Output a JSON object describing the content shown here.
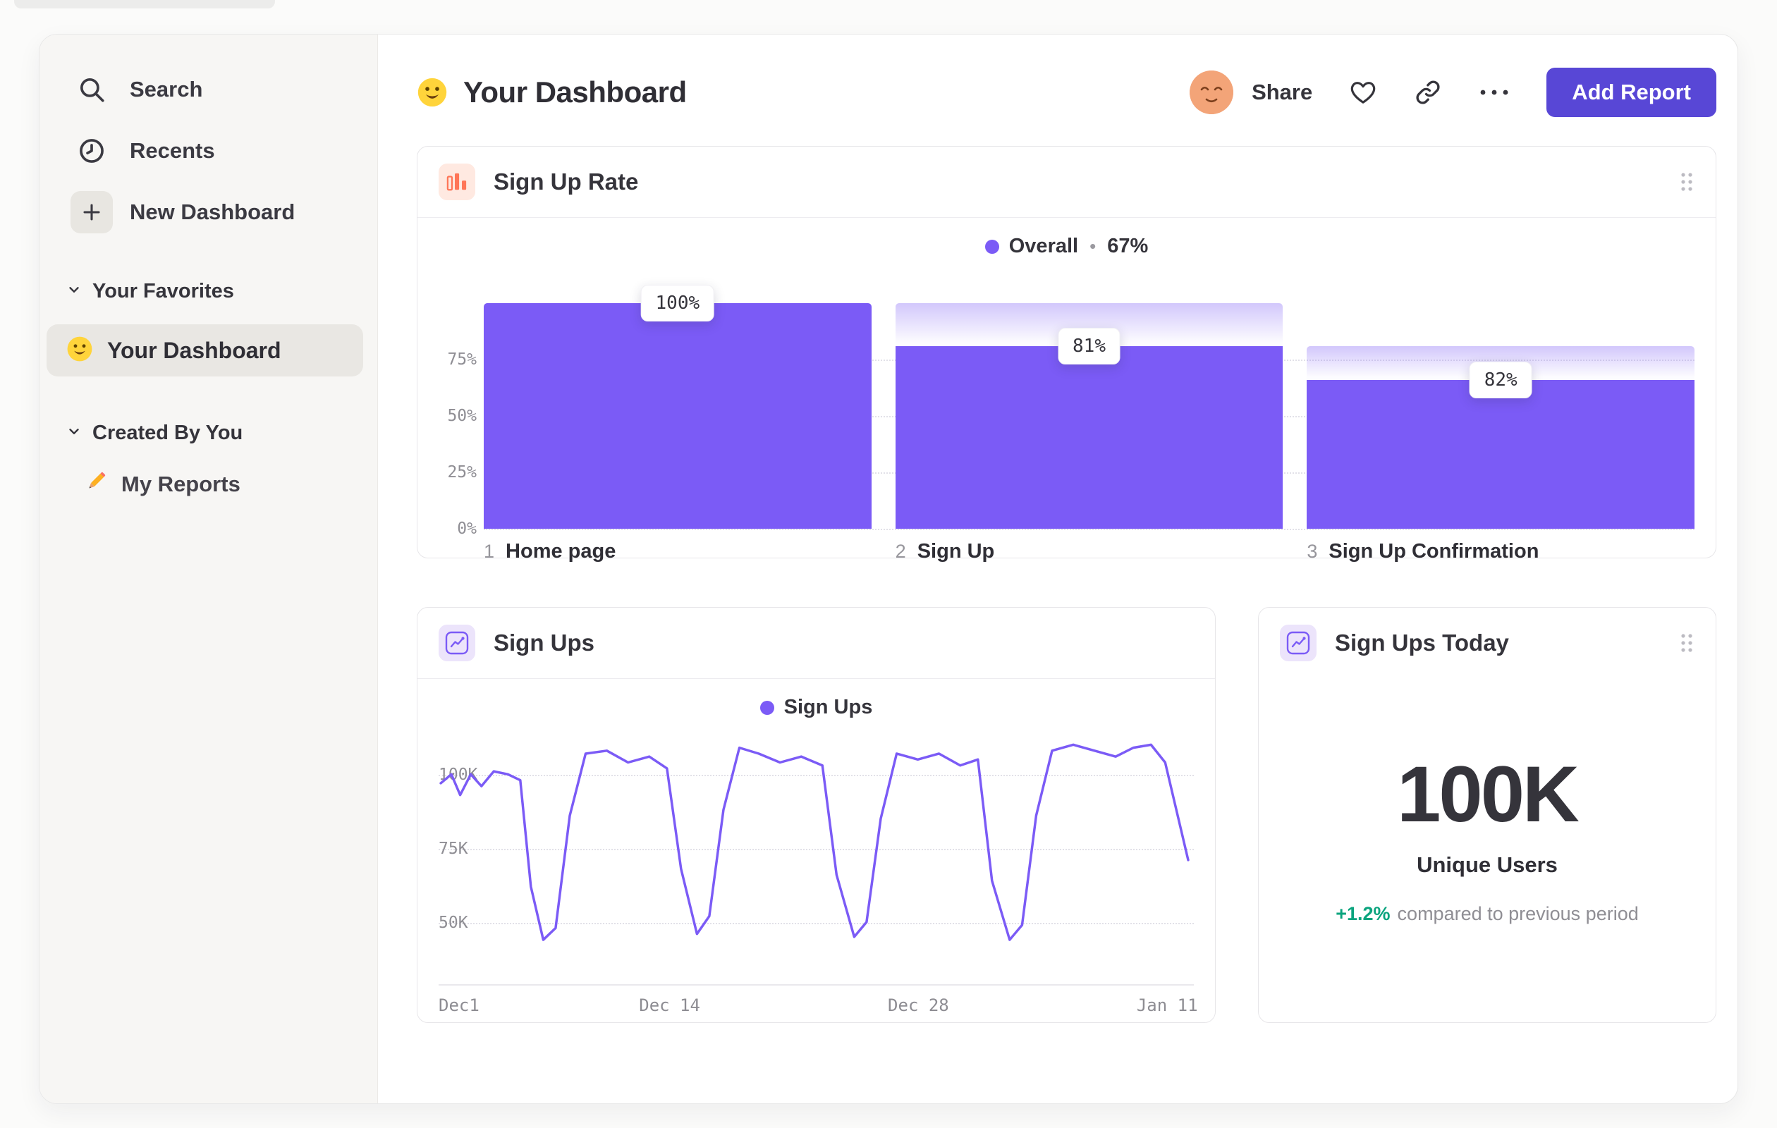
{
  "app": {
    "background": "#fbfbfa"
  },
  "colors": {
    "accent_purple": "#7b5bf6",
    "button_purple": "#5847d6",
    "accent_orange": "#ff7557",
    "positive_green": "#0ba47e"
  },
  "sidebar": {
    "nav": [
      {
        "label": "Search",
        "icon": "search-icon"
      },
      {
        "label": "Recents",
        "icon": "clock-icon"
      },
      {
        "label": "New Dashboard",
        "icon": "plus-icon"
      }
    ],
    "sections": [
      {
        "label": "Your Favorites",
        "items": [
          {
            "label": "Your Dashboard",
            "icon": "smiley-icon",
            "selected": true
          }
        ]
      },
      {
        "label": "Created By You",
        "items": [
          {
            "label": "My Reports",
            "icon": "pencil-icon",
            "selected": false
          }
        ]
      }
    ]
  },
  "header": {
    "title": "Your Dashboard",
    "title_icon": "smiley-icon",
    "avatar_icon": "relieved-face-icon",
    "share_label": "Share",
    "add_report_label": "Add Report"
  },
  "chart_data": [
    {
      "type": "bar",
      "variant": "funnel",
      "title": "Sign Up Rate",
      "legend": {
        "label": "Overall",
        "separator": "•",
        "value": "67%"
      },
      "ylabel_ticks": [
        "75%",
        "50%",
        "25%",
        "0%"
      ],
      "ylim": [
        0,
        100
      ],
      "steps": [
        {
          "num": "1",
          "label": "Home page",
          "value_label": "100%",
          "height_pct": 100
        },
        {
          "num": "2",
          "label": "Sign Up",
          "value_label": "81%",
          "height_pct": 81
        },
        {
          "num": "3",
          "label": "Sign Up Confirmation",
          "value_label": "82%",
          "height_pct": 66
        }
      ]
    },
    {
      "type": "line",
      "title": "Sign Ups",
      "legend": {
        "label": "Sign Ups"
      },
      "x_ticks": [
        {
          "label": "Dec1",
          "day": 0
        },
        {
          "label": "Dec 14",
          "day": 13
        },
        {
          "label": "Dec 28",
          "day": 27
        },
        {
          "label": "Jan 11",
          "day": 41
        }
      ],
      "x_range": [
        0,
        42.5
      ],
      "y_ticks": [
        {
          "label": "100K",
          "value": 100
        },
        {
          "label": "75K",
          "value": 75
        },
        {
          "label": "50K",
          "value": 50
        }
      ],
      "ylim": [
        29,
        112
      ],
      "unit": "K",
      "series": [
        {
          "name": "Sign Ups",
          "points": [
            [
              0,
              97
            ],
            [
              0.6,
              100
            ],
            [
              1.1,
              93
            ],
            [
              1.7,
              100
            ],
            [
              2.3,
              96
            ],
            [
              3,
              101
            ],
            [
              3.8,
              100
            ],
            [
              4.5,
              98
            ],
            [
              5.1,
              62
            ],
            [
              5.8,
              44
            ],
            [
              6.5,
              48
            ],
            [
              7.3,
              86
            ],
            [
              8.2,
              107
            ],
            [
              9.4,
              108
            ],
            [
              10.6,
              104
            ],
            [
              11.8,
              106
            ],
            [
              12.8,
              102
            ],
            [
              13.6,
              68
            ],
            [
              14.5,
              46
            ],
            [
              15.2,
              52
            ],
            [
              16,
              88
            ],
            [
              16.9,
              109
            ],
            [
              18,
              107
            ],
            [
              19.2,
              104
            ],
            [
              20.4,
              106
            ],
            [
              21.6,
              103
            ],
            [
              22.4,
              66
            ],
            [
              23.4,
              45
            ],
            [
              24.1,
              50
            ],
            [
              24.9,
              85
            ],
            [
              25.8,
              107
            ],
            [
              27,
              105
            ],
            [
              28.2,
              107
            ],
            [
              29.4,
              103
            ],
            [
              30.4,
              105
            ],
            [
              31.2,
              64
            ],
            [
              32.2,
              44
            ],
            [
              32.9,
              49
            ],
            [
              33.7,
              86
            ],
            [
              34.6,
              108
            ],
            [
              35.8,
              110
            ],
            [
              37,
              108
            ],
            [
              38.2,
              106
            ],
            [
              39.2,
              109
            ],
            [
              40.2,
              110
            ],
            [
              41,
              104
            ],
            [
              42.3,
              71
            ]
          ]
        }
      ]
    },
    {
      "type": "number",
      "title": "Sign Ups Today",
      "value": "100K",
      "label": "Unique Users",
      "delta": "+1.2%",
      "delta_note": "compared to previous period"
    }
  ]
}
